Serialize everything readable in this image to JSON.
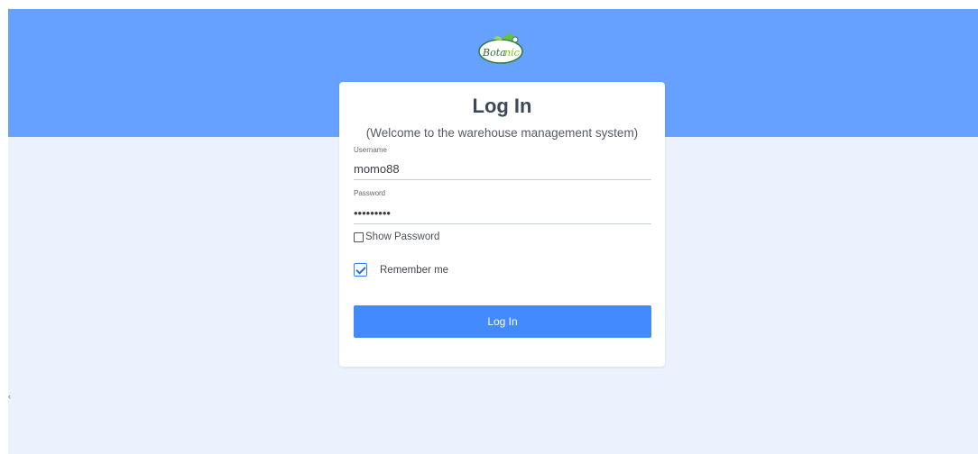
{
  "brand": {
    "logo_text": "Botanic"
  },
  "login": {
    "title": "Log In",
    "subtitle": "(Welcome to the warehouse management system)",
    "username_label": "Username",
    "username_value": "momo88",
    "password_label": "Password",
    "password_value": "•••••••••",
    "show_password_label": "Show Password",
    "show_password_checked": false,
    "remember_label": "Remember me",
    "remember_checked": true,
    "submit_label": "Log In"
  },
  "colors": {
    "hero": "#66a1ff",
    "background": "#ebf2fe",
    "button": "#448aff",
    "card": "#ffffff"
  },
  "misc": {
    "stray_char": "‹"
  }
}
